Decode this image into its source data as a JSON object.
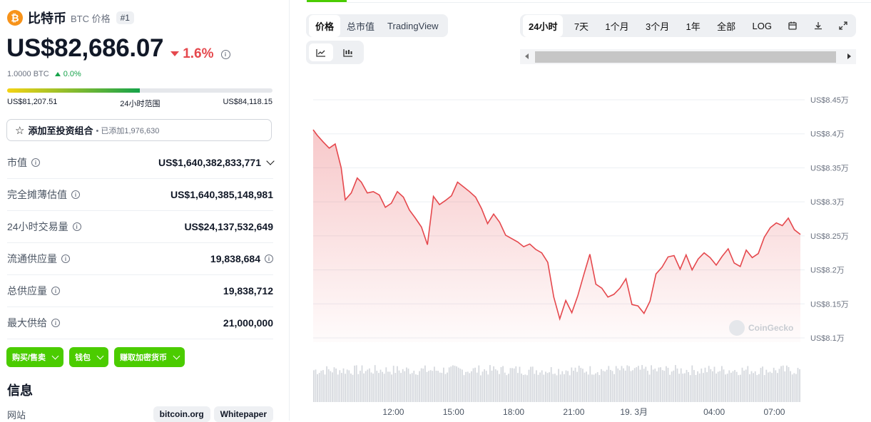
{
  "coin": {
    "icon_glyph": "₿",
    "name": "比特币",
    "symbol_label": "BTC 价格",
    "rank": "#1"
  },
  "price": {
    "value": "US$82,686.07",
    "change": "1.6%",
    "btc_value": "1.0000 BTC",
    "btc_change": "0.0%"
  },
  "range24": {
    "low": "US$81,207.51",
    "label": "24小时范围",
    "high": "US$84,118.15",
    "fill_fraction": 0.5
  },
  "portfolio": {
    "label": "添加至投资组合",
    "added": "• 已添加1,976,630"
  },
  "stats": [
    {
      "label": "市值",
      "value": "US$1,640,382,833,771"
    },
    {
      "label": "完全摊薄估值",
      "value": "US$1,640,385,148,981"
    },
    {
      "label": "24小时交易量",
      "value": "US$24,137,532,649"
    },
    {
      "label": "流通供应量",
      "value": "19,838,684"
    },
    {
      "label": "总供应量",
      "value": "19,838,712"
    },
    {
      "label": "最大供给",
      "value": "21,000,000"
    }
  ],
  "actions": {
    "buy": "购买/售卖",
    "wallet": "钱包",
    "earn": "赚取加密货币"
  },
  "info": {
    "heading": "信息",
    "website_label": "网站",
    "links": [
      "bitcoin.org",
      "Whitepaper"
    ]
  },
  "chart_tabs": [
    "价格",
    "总市值",
    "TradingView"
  ],
  "range_tabs": [
    "24小时",
    "7天",
    "1个月",
    "3个月",
    "1年",
    "全部",
    "LOG"
  ],
  "icons": {
    "line_chart": "line-chart-icon",
    "candle_chart": "candlestick-icon",
    "calendar": "calendar-icon",
    "download": "download-icon",
    "expand": "expand-icon"
  },
  "colors": {
    "accent_green": "#4bcc00",
    "down_red": "#e5484d",
    "up_green": "#16a34a",
    "bitcoin_orange": "#f7931a"
  },
  "watermark": "CoinGecko",
  "chart_data": {
    "type": "area",
    "y_tick_labels": [
      "US$8.45万",
      "US$8.4万",
      "US$8.35万",
      "US$8.3万",
      "US$8.25万",
      "US$8.2万",
      "US$8.15万",
      "US$8.1万"
    ],
    "y_ticks": [
      84500,
      84000,
      83500,
      83000,
      82500,
      82000,
      81500,
      81000
    ],
    "ylim": [
      81000,
      84500
    ],
    "x_tick_labels": [
      "12:00",
      "15:00",
      "18:00",
      "21:00",
      "19. 3月",
      "04:00",
      "07:00"
    ],
    "x_ticks": [
      12,
      15,
      18,
      21,
      24,
      28,
      31
    ],
    "xlim": [
      8.0,
      32.3
    ],
    "grid": true,
    "series": [
      {
        "x": [
          8.0,
          8.2,
          8.5,
          8.8,
          9.1,
          9.4,
          9.6,
          9.9,
          10.2,
          10.4,
          10.7,
          11.0,
          11.3,
          11.6,
          11.9,
          12.2,
          12.5,
          12.8,
          13.1,
          13.4,
          13.7,
          14.0,
          14.3,
          14.6,
          14.9,
          15.2,
          15.5,
          15.8,
          16.1,
          16.4,
          16.7,
          17.0,
          17.3,
          17.6,
          17.9,
          18.2,
          18.5,
          18.8,
          19.1,
          19.4,
          19.7,
          20.0,
          20.3,
          20.6,
          20.9,
          21.2,
          21.5,
          21.8,
          22.1,
          22.4,
          22.7,
          23.0,
          23.3,
          23.6,
          23.9,
          24.2,
          24.5,
          24.8,
          25.1,
          25.4,
          25.7,
          26.0,
          26.3,
          26.6,
          26.9,
          27.2,
          27.5,
          27.8,
          28.1,
          28.4,
          28.7,
          29.0,
          29.3,
          29.6,
          29.9,
          30.2,
          30.5,
          30.8,
          31.1,
          31.4,
          31.7,
          32.0,
          32.3
        ],
        "y": [
          84060,
          83980,
          83880,
          83790,
          83850,
          83500,
          83030,
          83130,
          83350,
          83290,
          83130,
          83150,
          83100,
          82920,
          82980,
          83150,
          83070,
          82880,
          82760,
          82630,
          82370,
          83080,
          82960,
          83020,
          83090,
          83290,
          83220,
          83150,
          83070,
          82900,
          82680,
          82820,
          82700,
          82510,
          82460,
          82410,
          82340,
          82380,
          82300,
          82250,
          82110,
          81600,
          81280,
          81550,
          81370,
          81620,
          81930,
          82230,
          81790,
          81730,
          81600,
          81640,
          81730,
          81870,
          81490,
          81470,
          81360,
          81540,
          81940,
          82040,
          82190,
          82210,
          82010,
          82220,
          82000,
          82160,
          82250,
          82180,
          82070,
          82200,
          82310,
          82100,
          82050,
          82290,
          82180,
          82240,
          82480,
          82620,
          82690,
          82650,
          82760,
          82590,
          82520
        ]
      }
    ]
  }
}
